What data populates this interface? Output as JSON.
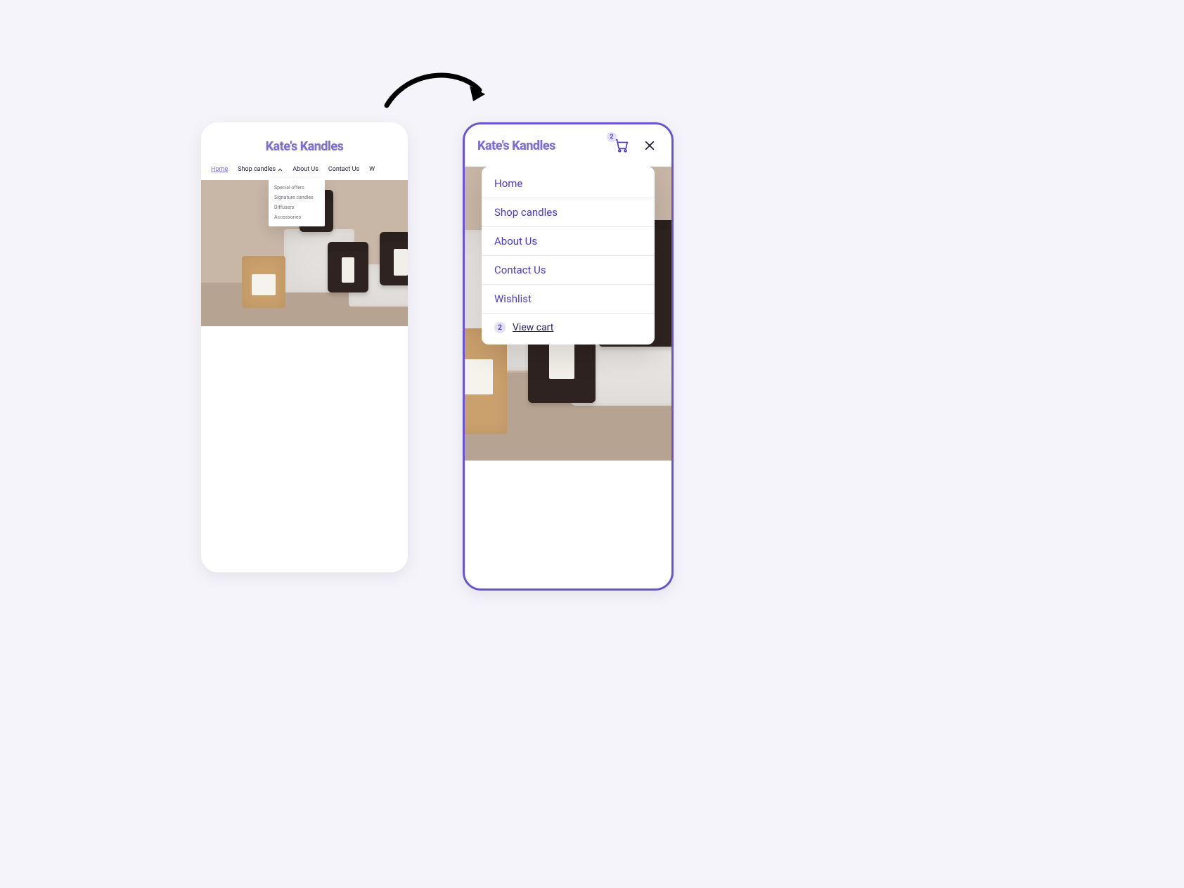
{
  "brand": "Kate's Kandles",
  "left": {
    "nav": {
      "home": "Home",
      "shop": "Shop candles",
      "about": "About Us",
      "contact": "Contact Us",
      "wishlist_prefix": "W"
    },
    "dropdown": {
      "special": "Special offers",
      "signature": "Signature candles",
      "diffusers": "Diffusers",
      "accessories": "Accessories"
    }
  },
  "right": {
    "cart_count": "2",
    "menu": {
      "home": "Home",
      "shop": "Shop candles",
      "about": "About Us",
      "contact": "Contact Us",
      "wishlist": "Wishlist"
    },
    "cart_badge": "2",
    "view_cart": "View cart"
  }
}
